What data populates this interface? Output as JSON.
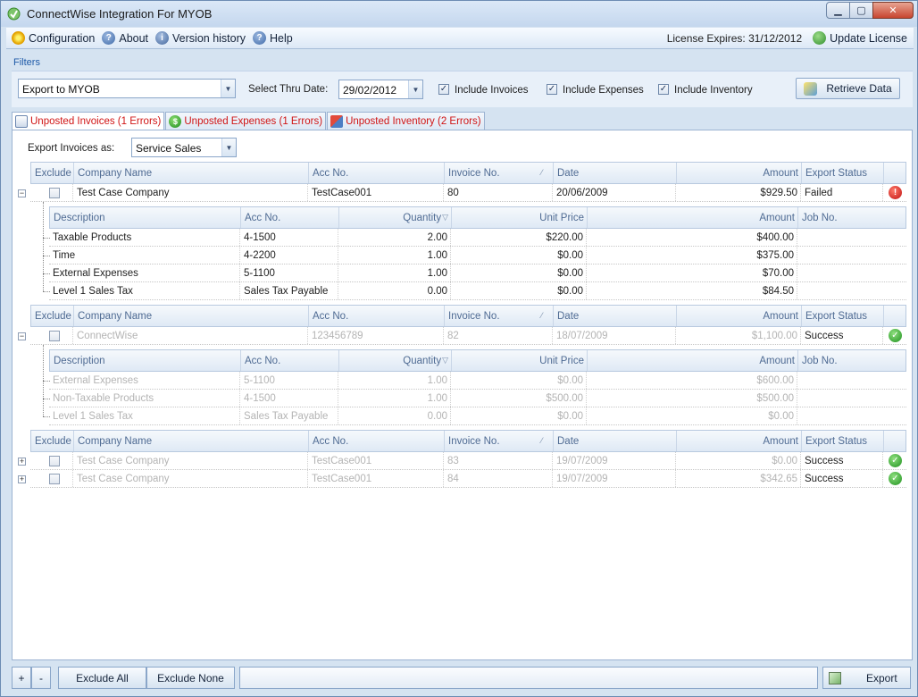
{
  "window": {
    "title": "ConnectWise Integration For MYOB",
    "controls": [
      "minimize",
      "maximize",
      "close"
    ]
  },
  "menu": {
    "items": [
      {
        "label": "Configuration",
        "icon": "gear-icon"
      },
      {
        "label": "About",
        "icon": "help-icon"
      },
      {
        "label": "Version history",
        "icon": "info-icon"
      },
      {
        "label": "Help",
        "icon": "help-icon"
      }
    ],
    "license_expires": "License Expires: 31/12/2012",
    "update_license": "Update License"
  },
  "filters": {
    "heading": "Filters",
    "export_target": "Export to MYOB",
    "thru_date_label": "Select Thru Date:",
    "thru_date": "29/02/2012",
    "include_invoices": "Include Invoices",
    "include_expenses": "Include Expenses",
    "include_inventory": "Include Inventory",
    "retrieve_button": "Retrieve Data"
  },
  "tabs": [
    {
      "label": "Unposted Invoices (1 Errors)",
      "active": true
    },
    {
      "label": "Unposted Expenses (1 Errors)",
      "active": false
    },
    {
      "label": "Unposted Inventory (2 Errors)",
      "active": false
    }
  ],
  "export_as": {
    "label": "Export Invoices as:",
    "value": "Service Sales"
  },
  "invoice_headers": [
    "Exclude",
    "Company Name",
    "Acc No.",
    "Invoice No.",
    "Date",
    "Amount",
    "Export Status"
  ],
  "line_headers": [
    "Description",
    "Acc No.",
    "Quantity",
    "Unit Price",
    "Amount",
    "Job No."
  ],
  "groups": [
    {
      "invoice": {
        "company": "Test Case Company",
        "acc": "TestCase001",
        "invoice_no": "80",
        "date": "20/06/2009",
        "amount": "$929.50",
        "status": "Failed",
        "dimmed": false
      },
      "lines": [
        {
          "desc": "Taxable Products",
          "acc": "4-1500",
          "qty": "2.00",
          "unit": "$220.00",
          "amount": "$400.00"
        },
        {
          "desc": "Time",
          "acc": "4-2200",
          "qty": "1.00",
          "unit": "$0.00",
          "amount": "$375.00"
        },
        {
          "desc": "External Expenses",
          "acc": "5-1100",
          "qty": "1.00",
          "unit": "$0.00",
          "amount": "$70.00"
        },
        {
          "desc": "Level 1 Sales Tax",
          "acc": "Sales Tax Payable",
          "qty": "0.00",
          "unit": "$0.00",
          "amount": "$84.50"
        }
      ]
    },
    {
      "invoice": {
        "company": "ConnectWise",
        "acc": "123456789",
        "invoice_no": "82",
        "date": "18/07/2009",
        "amount": "$1,100.00",
        "status": "Success",
        "dimmed": true
      },
      "lines": [
        {
          "desc": "External Expenses",
          "acc": "5-1100",
          "qty": "1.00",
          "unit": "$0.00",
          "amount": "$600.00"
        },
        {
          "desc": "Non-Taxable Products",
          "acc": "4-1500",
          "qty": "1.00",
          "unit": "$500.00",
          "amount": "$500.00"
        },
        {
          "desc": "Level 1 Sales Tax",
          "acc": "Sales Tax Payable",
          "qty": "0.00",
          "unit": "$0.00",
          "amount": "$0.00"
        }
      ]
    }
  ],
  "collapsed_invoices": [
    {
      "company": "Test Case Company",
      "acc": "TestCase001",
      "invoice_no": "83",
      "date": "19/07/2009",
      "amount": "$0.00",
      "status": "Success"
    },
    {
      "company": "Test Case Company",
      "acc": "TestCase001",
      "invoice_no": "84",
      "date": "19/07/2009",
      "amount": "$342.65",
      "status": "Success"
    }
  ],
  "bottom": {
    "plus": "+",
    "minus": "-",
    "exclude_all": "Exclude All",
    "exclude_none": "Exclude None",
    "export": "Export"
  },
  "colors": {
    "error_tab_text": "#d01414",
    "link_blue": "#1e5aa8",
    "header_text": "#4f6b93"
  }
}
